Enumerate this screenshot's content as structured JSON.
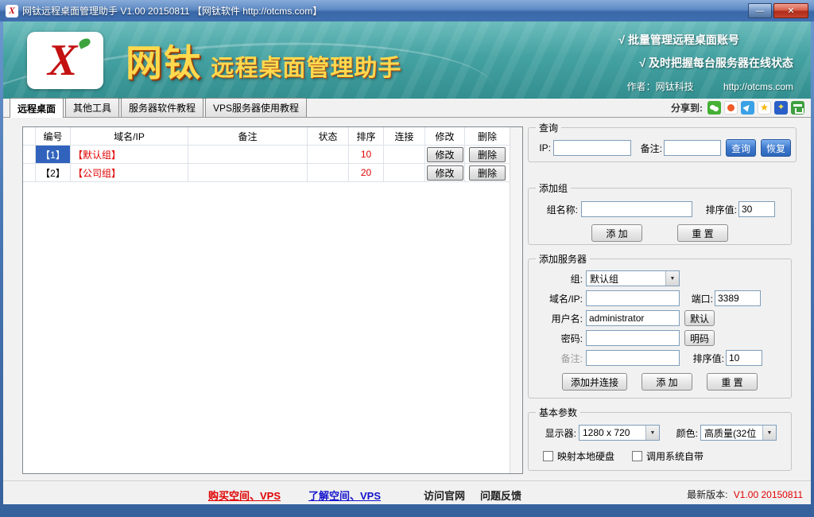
{
  "window": {
    "title": "网钛远程桌面管理助手 V1.00 20150811 【网钛软件 http://otcms.com】",
    "minimize_glyph": "—",
    "close_glyph": "✕"
  },
  "header": {
    "logo_glyph": "X",
    "brand": "网钛",
    "brand_sub": "远程桌面管理助手",
    "feature_1": "√ 批量管理远程桌面账号",
    "feature_2": "√ 及时把握每台服务器在线状态",
    "author": "作者：网钛科技",
    "site": "http://otcms.com"
  },
  "tabs": {
    "items": [
      {
        "label": "远程桌面"
      },
      {
        "label": "其他工具"
      },
      {
        "label": "服务器软件教程"
      },
      {
        "label": "VPS服务器使用教程"
      }
    ],
    "share_label": "分享到:",
    "share_icons": [
      "wechat",
      "kaixin",
      "tencent-weibo",
      "favorites",
      "qzone",
      "douban"
    ],
    "fav_glyph": "★",
    "qzone_glyph": "✦"
  },
  "table": {
    "headers": [
      "编号",
      "域名/IP",
      "备注",
      "状态",
      "排序",
      "连接",
      "修改",
      "删除"
    ],
    "rows": [
      {
        "no": "【1】",
        "name": "【默认组】",
        "note": "",
        "status": "",
        "order": "10",
        "connect": "",
        "modify": "修改",
        "delete": "删除"
      },
      {
        "no": "【2】",
        "name": "【公司组】",
        "note": "",
        "status": "",
        "order": "20",
        "connect": "",
        "modify": "修改",
        "delete": "删除"
      }
    ]
  },
  "query": {
    "title": "查询",
    "ip_label": "IP:",
    "note_label": "备注:",
    "search_btn": "查询",
    "restore_btn": "恢复"
  },
  "add_group": {
    "title": "添加组",
    "name_label": "组名称:",
    "order_label": "排序值:",
    "order_value": "30",
    "add_btn": "添 加",
    "reset_btn": "重 置"
  },
  "add_server": {
    "title": "添加服务器",
    "group_label": "组:",
    "group_value": "默认组",
    "host_label": "域名/IP:",
    "port_label": "端口:",
    "port_value": "3389",
    "user_label": "用户名:",
    "user_value": "administrator",
    "default_btn": "默认",
    "pwd_label": "密码:",
    "plain_btn": "明码",
    "note_label": "备注:",
    "order_label": "排序值:",
    "order_value": "10",
    "add_connect_btn": "添加并连接",
    "add_btn": "添 加",
    "reset_btn": "重 置"
  },
  "basic": {
    "title": "基本参数",
    "display_label": "显示器:",
    "display_value": "1280 x 720",
    "color_label": "颜色:",
    "color_value": "高质量(32位",
    "check_1": "映射本地硬盘",
    "check_2": "调用系统自带"
  },
  "footer": {
    "buy": "购买空间、VPS",
    "learn": "了解空间、VPS",
    "official": "访问官网",
    "feedback": "问题反馈",
    "version_label": "最新版本:",
    "version": "V1.00 20150811"
  },
  "colors": {
    "accent_red": "#e00000",
    "header_teal": "#45a2a2",
    "title_gold": "#ffd94e",
    "selected_row_blue": "#3163bd"
  }
}
